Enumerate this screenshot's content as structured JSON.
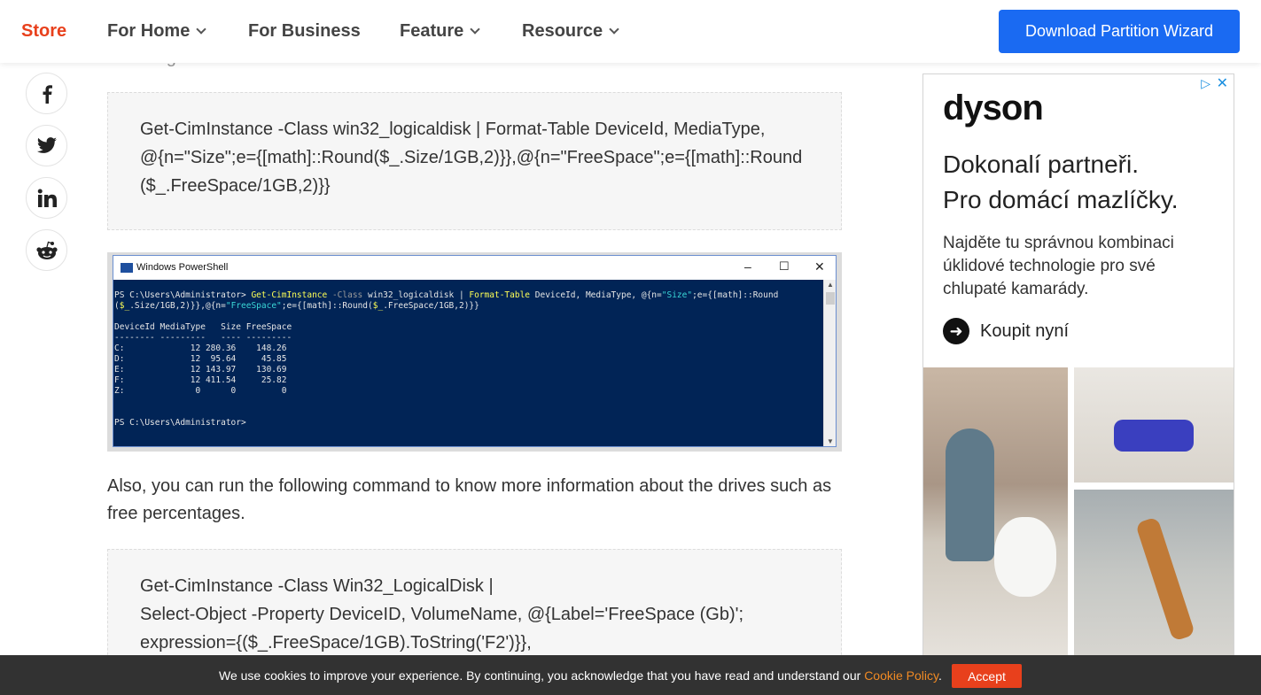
{
  "nav": {
    "store": "Store",
    "items": [
      {
        "label": "For Home",
        "has_dropdown": true
      },
      {
        "label": "For Business",
        "has_dropdown": false
      },
      {
        "label": "Feature",
        "has_dropdown": true
      },
      {
        "label": "Resource",
        "has_dropdown": true
      }
    ],
    "cta": "Download Partition Wizard"
  },
  "faded_text": "following command in PowerShell:",
  "social": [
    {
      "icon": "facebook-icon"
    },
    {
      "icon": "twitter-icon"
    },
    {
      "icon": "linkedin-icon"
    },
    {
      "icon": "reddit-icon"
    }
  ],
  "code_block_1": {
    "lines": [
      "Get-CimInstance -Class win32_logicaldisk | Format-Table DeviceId, MediaType,",
      "@{n=\"Size\";e={[math]::Round($_.Size/1GB,2)}},@{n=\"FreeSpace\";e={[math]::Round",
      "($_.FreeSpace/1GB,2)}}"
    ]
  },
  "powershell": {
    "title": "Windows PowerShell",
    "prompt1_prefix": "PS C:\\Users\\Administrator> ",
    "cmd_part1": "Get-CimInstance",
    "cmd_part2": " -Class",
    "cmd_part3": " win32_logicaldisk | ",
    "cmd_part4": "Format-Table",
    "cmd_part5": " DeviceId, MediaType, @{n=",
    "cmd_part6": "\"Size\"",
    "cmd_part7": ";e={[math]::Round",
    "line2_part1": "(",
    "line2_part2": "$_",
    "line2_part3": ".Size/1GB,2)}},@{n=",
    "line2_part4": "\"FreeSpace\"",
    "line2_part5": ";e={[math]::Round(",
    "line2_part6": "$_",
    "line2_part7": ".FreeSpace/1GB,2)}}",
    "table_header": "DeviceId MediaType   Size FreeSpace",
    "table_rule": "-------- ---------   ---- ---------",
    "rows": [
      "C:             12 280.36    148.26",
      "D:             12  95.64     45.85",
      "E:             12 143.97    130.69",
      "F:             12 411.54     25.82",
      "Z:              0      0         0"
    ],
    "prompt2": "PS C:\\Users\\Administrator>"
  },
  "paragraph": "Also, you can run the following command to know more information about the drives such as free percentages.",
  "code_block_2": {
    "lines": [
      "Get-CimInstance -Class Win32_LogicalDisk |",
      "Select-Object -Property DeviceID, VolumeName, @{Label='FreeSpace (Gb)';",
      "expression={($_.FreeSpace/1GB).ToString('F2')}},"
    ]
  },
  "ad": {
    "brand": "dyson",
    "headline_1": "Dokonalí partneři.",
    "headline_2": "Pro domácí mazlíčky.",
    "body": "Najděte tu správnou kombinaci úklidové technologie pro své chlupaté kamarády.",
    "cta": "Koupit nyní"
  },
  "cookie": {
    "message": "We use cookies to improve your experience. By continuing, you acknowledge that you have read and understand our ",
    "link": "Cookie Policy",
    "period": ".",
    "accept": "Accept"
  },
  "colors": {
    "brand_red": "#e8401c",
    "cta_blue": "#1a6af2",
    "console_bg": "#012456"
  }
}
